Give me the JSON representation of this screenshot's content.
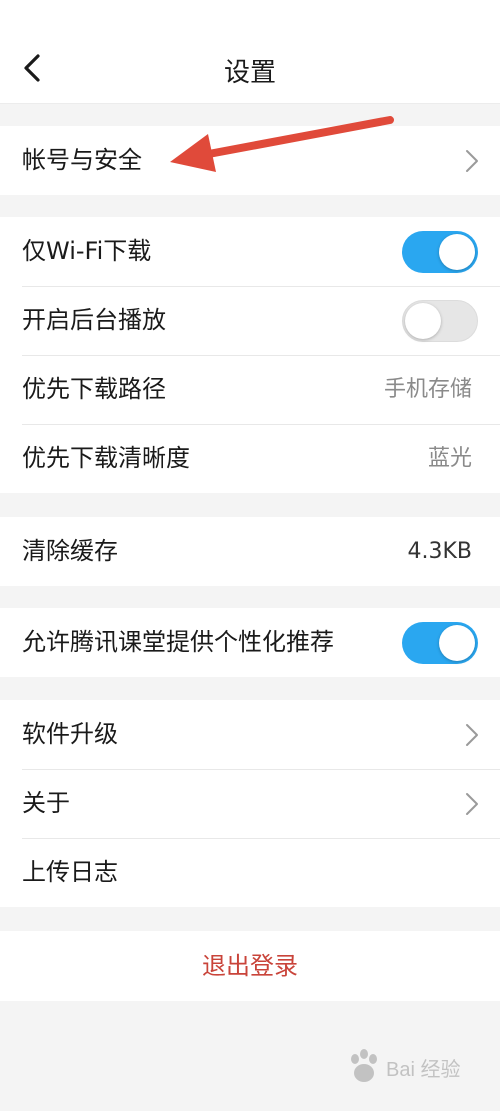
{
  "navbar": {
    "title": "设置"
  },
  "groups": {
    "account": {
      "label": "帐号与安全"
    },
    "download": {
      "wifi_only": {
        "label": "仅Wi-Fi下载",
        "enabled": true
      },
      "background_play": {
        "label": "开启后台播放",
        "enabled": false
      },
      "download_path": {
        "label": "优先下载路径",
        "value": "手机存储"
      },
      "download_quality": {
        "label": "优先下载清晰度",
        "value": "蓝光"
      }
    },
    "cache": {
      "label": "清除缓存",
      "value": "4.3KB"
    },
    "personalize": {
      "label": "允许腾讯课堂提供个性化推荐",
      "enabled": true
    },
    "about": {
      "upgrade": {
        "label": "软件升级"
      },
      "about": {
        "label": "关于"
      },
      "upload_log": {
        "label": "上传日志"
      }
    }
  },
  "logout": {
    "label": "退出登录"
  },
  "watermark": {
    "text": "Bai 经验",
    "logo": "paw-icon"
  },
  "colors": {
    "accent": "#2aa7f0",
    "logout": "#c9443a",
    "annotation_arrow": "#e04a3a",
    "background": "#f4f4f4"
  }
}
